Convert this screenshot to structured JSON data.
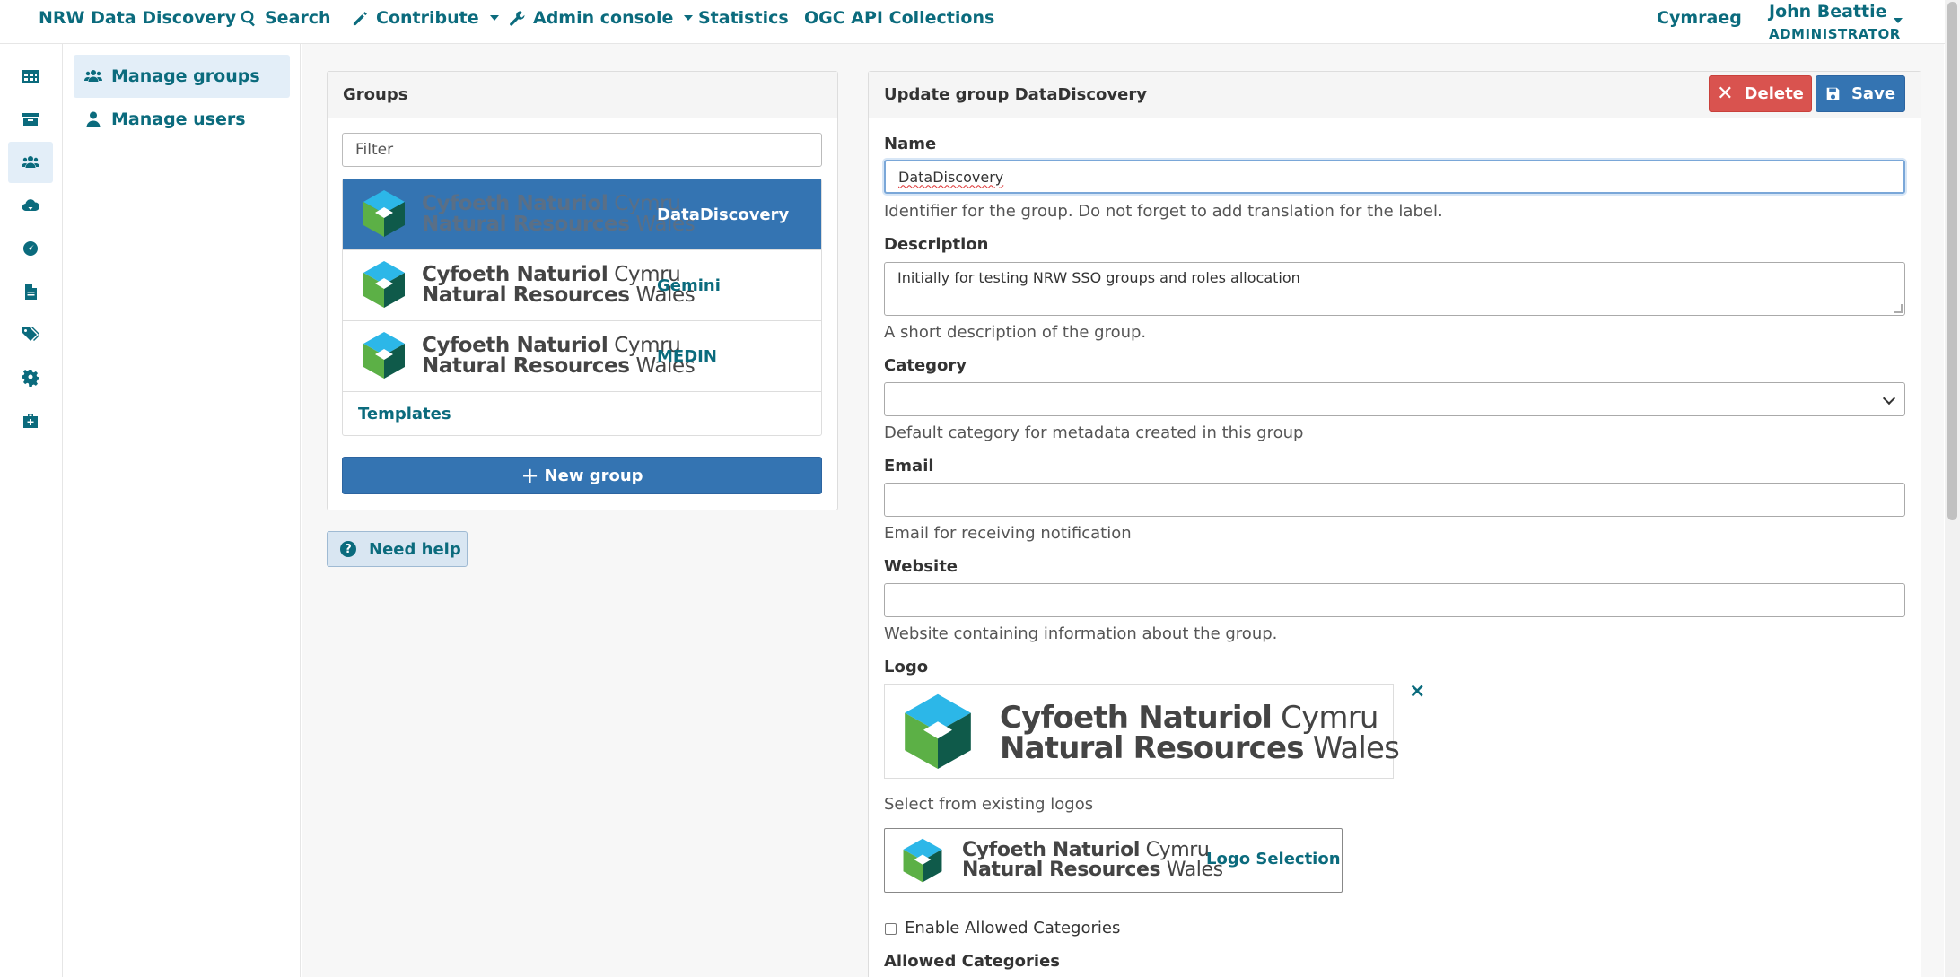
{
  "nav": {
    "brand": "NRW Data Discovery",
    "search": "Search",
    "contribute": "Contribute",
    "admin_console": "Admin console",
    "statistics": "Statistics",
    "ogc": "OGC API Collections",
    "language": "Cymraeg",
    "user_name": "John Beattie",
    "user_role": "ADMINISTRATOR"
  },
  "rail": {
    "icons": [
      "table-icon",
      "archive-icon",
      "users-icon",
      "cloud-download-icon",
      "dashboard-icon",
      "file-icon",
      "tags-icon",
      "gear-icon",
      "medkit-icon"
    ]
  },
  "submenu": {
    "groups": "Manage groups",
    "users": "Manage users"
  },
  "groups_panel": {
    "title": "Groups",
    "filter_placeholder": "Filter",
    "items": [
      {
        "name": "DataDiscovery"
      },
      {
        "name": "Gemini"
      },
      {
        "name": "MEDIN"
      }
    ],
    "templates": "Templates",
    "new_group": "New group",
    "help": "Need help"
  },
  "logo": {
    "line1_bold": "Cyfoeth Naturiol",
    "line1_light": "Cymru",
    "line2_bold": "Natural Resources",
    "line2_light": "Wales",
    "colors": {
      "cyan": "#2cb7e8",
      "green": "#5cb046",
      "dark": "#0f5a4a"
    }
  },
  "update": {
    "title": "Update group DataDiscovery",
    "delete": "Delete",
    "save": "Save",
    "name_label": "Name",
    "name_value": "DataDiscovery",
    "name_help": "Identifier for the group. Do not forget to add translation for the label.",
    "desc_label": "Description",
    "desc_value": "Initially for testing NRW SSO groups and roles allocation",
    "desc_help": "A short description of the group.",
    "category_label": "Category",
    "category_value": "",
    "category_help": "Default category for metadata created in this group",
    "email_label": "Email",
    "email_value": "",
    "email_help": "Email for receiving notification",
    "website_label": "Website",
    "website_value": "",
    "website_help": "Website containing information about the group.",
    "logo_label": "Logo",
    "logo_remove": "×",
    "select_logos": "Select from existing logos",
    "logo_selection": "Logo Selection",
    "enable_allowed": "Enable Allowed Categories",
    "allowed_label": "Allowed Categories"
  },
  "colors": {
    "accent": "#0b6b7d",
    "primary": "#3474b2",
    "danger": "#d9534f"
  }
}
